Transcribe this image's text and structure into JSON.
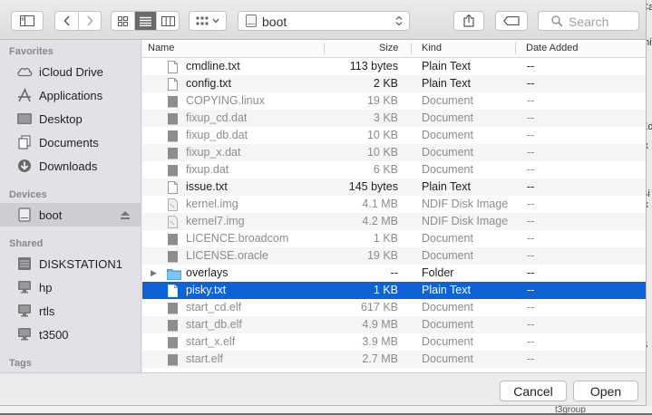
{
  "toolbar": {
    "location": "boot",
    "search_placeholder": "Search"
  },
  "sidebar": {
    "favorites_title": "Favorites",
    "favorites": [
      {
        "label": "iCloud Drive",
        "icon": "cloud-icon"
      },
      {
        "label": "Applications",
        "icon": "applications-icon"
      },
      {
        "label": "Desktop",
        "icon": "desktop-icon"
      },
      {
        "label": "Documents",
        "icon": "documents-icon"
      },
      {
        "label": "Downloads",
        "icon": "downloads-icon"
      }
    ],
    "devices_title": "Devices",
    "devices": [
      {
        "label": "boot",
        "icon": "drive-icon",
        "selected": true
      }
    ],
    "shared_title": "Shared",
    "shared": [
      {
        "label": "DISKSTATION1",
        "icon": "server-icon"
      },
      {
        "label": "hp",
        "icon": "computer-icon"
      },
      {
        "label": "rtls",
        "icon": "computer-icon"
      },
      {
        "label": "t3500",
        "icon": "computer-icon"
      }
    ],
    "tags_title": "Tags"
  },
  "columns": {
    "name": "Name",
    "size": "Size",
    "kind": "Kind",
    "date": "Date Added"
  },
  "files": [
    {
      "name": "cmdline.txt",
      "size": "113 bytes",
      "kind": "Plain Text",
      "date": "--",
      "type": "text",
      "enabled": true
    },
    {
      "name": "config.txt",
      "size": "2 KB",
      "kind": "Plain Text",
      "date": "--",
      "type": "text",
      "enabled": true
    },
    {
      "name": "COPYING.linux",
      "size": "19 KB",
      "kind": "Document",
      "date": "--",
      "type": "doc",
      "enabled": false
    },
    {
      "name": "fixup_cd.dat",
      "size": "3 KB",
      "kind": "Document",
      "date": "--",
      "type": "doc",
      "enabled": false
    },
    {
      "name": "fixup_db.dat",
      "size": "10 KB",
      "kind": "Document",
      "date": "--",
      "type": "doc",
      "enabled": false
    },
    {
      "name": "fixup_x.dat",
      "size": "10 KB",
      "kind": "Document",
      "date": "--",
      "type": "doc",
      "enabled": false
    },
    {
      "name": "fixup.dat",
      "size": "6 KB",
      "kind": "Document",
      "date": "--",
      "type": "doc",
      "enabled": false
    },
    {
      "name": "issue.txt",
      "size": "145 bytes",
      "kind": "Plain Text",
      "date": "--",
      "type": "text",
      "enabled": true
    },
    {
      "name": "kernel.img",
      "size": "4.1 MB",
      "kind": "NDIF Disk Image",
      "date": "--",
      "type": "img",
      "enabled": false
    },
    {
      "name": "kernel7.img",
      "size": "4.2 MB",
      "kind": "NDIF Disk Image",
      "date": "--",
      "type": "img",
      "enabled": false
    },
    {
      "name": "LICENCE.broadcom",
      "size": "1 KB",
      "kind": "Document",
      "date": "--",
      "type": "doc",
      "enabled": false
    },
    {
      "name": "LICENSE.oracle",
      "size": "19 KB",
      "kind": "Document",
      "date": "--",
      "type": "doc",
      "enabled": false
    },
    {
      "name": "overlays",
      "size": "--",
      "kind": "Folder",
      "date": "--",
      "type": "folder",
      "enabled": true
    },
    {
      "name": "pisky.txt",
      "size": "1 KB",
      "kind": "Plain Text",
      "date": "--",
      "type": "text",
      "enabled": true,
      "selected": true
    },
    {
      "name": "start_cd.elf",
      "size": "617 KB",
      "kind": "Document",
      "date": "--",
      "type": "doc",
      "enabled": false
    },
    {
      "name": "start_db.elf",
      "size": "4.9 MB",
      "kind": "Document",
      "date": "--",
      "type": "doc",
      "enabled": false
    },
    {
      "name": "start_x.elf",
      "size": "3.9 MB",
      "kind": "Document",
      "date": "--",
      "type": "doc",
      "enabled": false
    },
    {
      "name": "start.elf",
      "size": "2.7 MB",
      "kind": "Document",
      "date": "--",
      "type": "doc",
      "enabled": false
    }
  ],
  "footer": {
    "cancel_label": "Cancel",
    "open_label": "Open"
  },
  "colors": {
    "selection": "#0d63d6",
    "sidebar": "#e3e1e5"
  },
  "background_window": {
    "right_edge_fragments": [
      "Ca",
      "mi",
      "Ed",
      "ix",
      "Bi",
      "ix",
      "S",
      "r"
    ],
    "bottom_fragment": "t3group"
  }
}
